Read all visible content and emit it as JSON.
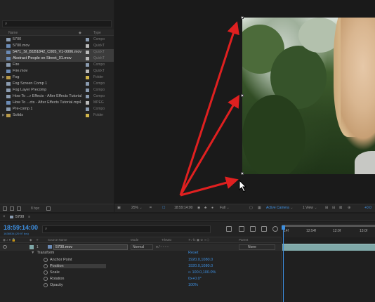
{
  "project": {
    "search_icon": "search-icon",
    "columns": {
      "name": "Name",
      "type": "Type"
    },
    "items": [
      {
        "name": "5700",
        "type": "Compo",
        "kind": "comp",
        "label_color": "#8a9bb0",
        "selected": false,
        "twirl": ""
      },
      {
        "name": "5700.mov",
        "type": "QuickT",
        "kind": "footage",
        "label_color": "#b9b9b9",
        "selected": false,
        "twirl": ""
      },
      {
        "name": "5471_SI_B1B1842_C005_V1-0006.mov",
        "type": "QuickT",
        "kind": "footage",
        "label_color": "#b9b9b9",
        "selected": true,
        "twirl": ""
      },
      {
        "name": "Abstract People on Street_01.mov",
        "type": "QuickT",
        "kind": "footage",
        "label_color": "#b9b9b9",
        "selected": true,
        "twirl": ""
      },
      {
        "name": "Fire",
        "type": "Compo",
        "kind": "comp",
        "label_color": "#8a9bb0",
        "selected": false,
        "twirl": ""
      },
      {
        "name": "Fire.mov",
        "type": "QuickT",
        "kind": "footage",
        "label_color": "#b9b9b9",
        "selected": false,
        "twirl": ""
      },
      {
        "name": "Fog",
        "type": "Folder",
        "kind": "folder",
        "label_color": "#d1b54a",
        "selected": false,
        "twirl": "▶"
      },
      {
        "name": "Fog Screen Comp 1",
        "type": "Compo",
        "kind": "comp",
        "label_color": "#8a9bb0",
        "selected": false,
        "twirl": ""
      },
      {
        "name": "Fog Layer Precomp",
        "type": "Compo",
        "kind": "comp",
        "label_color": "#8a9bb0",
        "selected": false,
        "twirl": ""
      },
      {
        "name": "How To ...r Effects - After Effects Tutorial",
        "type": "Compo",
        "kind": "comp",
        "label_color": "#8a9bb0",
        "selected": false,
        "twirl": ""
      },
      {
        "name": "How To ...cts - After Effects Tutorial.mp4",
        "type": "MPEG",
        "kind": "footage",
        "label_color": "#b9b9b9",
        "selected": false,
        "twirl": ""
      },
      {
        "name": "Pre-comp 1",
        "type": "Compo",
        "kind": "comp",
        "label_color": "#8a9bb0",
        "selected": false,
        "twirl": ""
      },
      {
        "name": "Solids",
        "type": "Folder",
        "kind": "folder",
        "label_color": "#d1b54a",
        "selected": false,
        "twirl": "▶"
      }
    ],
    "bpc": "8 bpc"
  },
  "viewer_bar": {
    "zoom": "25%",
    "timecode": "18:59:14:00",
    "resolution": "Full",
    "camera": "Active Camera",
    "views": "1 View",
    "exposure": "+0.0"
  },
  "timeline": {
    "comp_name": "5700",
    "timecode": "18:59:14:00",
    "fps": "1638534 (29.97 fps)",
    "search_placeholder": "",
    "columns": {
      "source_name": "Source Name",
      "mode": "Mode",
      "trkmat": "TrkMat",
      "parent": "Parent"
    },
    "layer": {
      "number": "1",
      "name": "5700.mov",
      "mode": "Normal",
      "parent": "None"
    },
    "transform_label": "Transform",
    "reset_label": "Reset",
    "properties": [
      {
        "name": "Anchor Point",
        "value": "1920.0,1080.0",
        "highlight": false
      },
      {
        "name": "Position",
        "value": "1920.0,1080.0",
        "highlight": true
      },
      {
        "name": "Scale",
        "value": "∞ 100.0,100.0%",
        "highlight": false
      },
      {
        "name": "Rotation",
        "value": "0x+0.0°",
        "highlight": false
      },
      {
        "name": "Opacity",
        "value": "100%",
        "highlight": false
      }
    ],
    "ruler_ticks": [
      "14f",
      "12:54f",
      "12:0f",
      "13:0f"
    ]
  },
  "colors": {
    "accent_blue": "#3d8fe0",
    "annotation_red": "#e02020",
    "clip_teal": "#7fa8a8"
  }
}
